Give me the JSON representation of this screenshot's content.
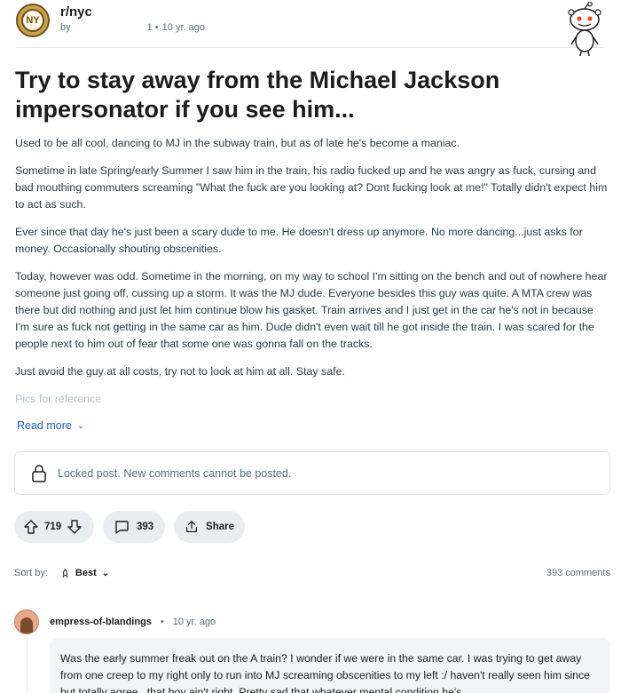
{
  "header": {
    "subreddit": "r/nyc",
    "by_label": "by",
    "meta_sep": "1 •",
    "time": "10 yr. ago",
    "avatar_text": "NY"
  },
  "post": {
    "title": "Try to stay away from the Michael Jackson impersonator if you see him...",
    "paragraphs": [
      "Used to be all cool, dancing to MJ in the subway train, but as of late he's become a maniac.",
      "Sometime in late Spring/early Summer I saw him in the train, his radio fucked up and he was angry as fuck, cursing and bad mouthing commuters screaming \"What the fuck are you looking at? Dont fucking look at me!\" Totally didn't expect him to act as such.",
      "Ever since that day he's just been a scary dude to me. He doesn't dress up anymore. No more dancing...just asks for money. Occasionally shouting obscenities.",
      "Today, however was odd. Sometime in the morning, on my way to school I'm sitting on the bench and out of nowhere hear someone just going off, cussing up a storm. It was the MJ dude. Everyone besides this guy was quite. A MTA crew was there but did nothing and just let him continue blow his gasket. Train arrives and I just get in the car he's not in because I'm sure as fuck not getting in the same car as him. Dude didn't even wait till he got inside the train. I was scared for the people next to him out of fear that some one was gonna fall on the tracks.",
      "Just avoid the guy at all costs, try not to look at him at all. Stay safe.",
      "Pics for reference"
    ],
    "read_more": "Read more",
    "locked_text": "Locked post. New comments cannot be posted.",
    "votes": "719",
    "comments": "393",
    "share": "Share"
  },
  "sort": {
    "label": "Sort by:",
    "value": "Best",
    "count": "393 comments"
  },
  "comment": {
    "author": "empress-of-blandings",
    "dot": "•",
    "time": "10 yr. ago",
    "text": "Was the early summer freak out on the A train? I wonder if we were in the same car. I was trying to get away from one creep to my right only to run into MJ screaming obscenities to my left :/ haven't really seen him since but totally agree...that boy ain't right. Pretty sad that whatever mental condition he's"
  },
  "colors": {
    "link": "#1a5ec0",
    "pill_bg": "#eaedef",
    "meta": "#576f76"
  }
}
